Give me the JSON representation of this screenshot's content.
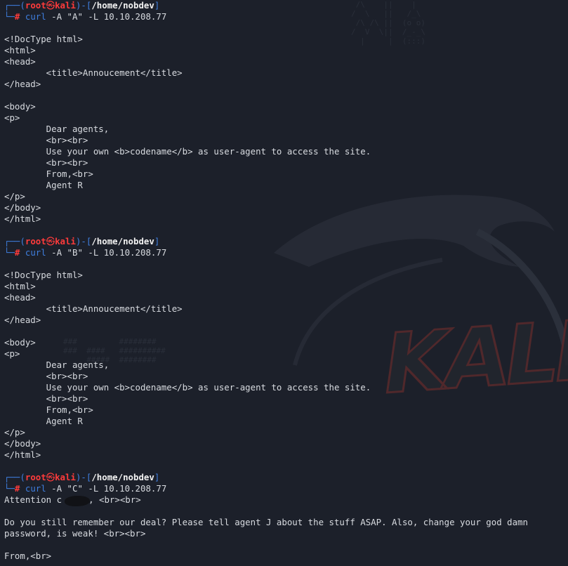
{
  "prompt": {
    "user": "root",
    "skull_glyph": "㉿",
    "host": "kali",
    "path": "/home/nobdev",
    "symbol": "#"
  },
  "sessions": [
    {
      "command": "curl",
      "args": " -A \"A\" -L 10.10.208.77",
      "output": [
        "",
        "<!DocType html>",
        "<html>",
        "<head>",
        "        <title>Annoucement</title>",
        "</head>",
        "",
        "<body>",
        "<p>",
        "        Dear agents,",
        "        <br><br>",
        "        Use your own <b>codename</b> as user-agent to access the site.",
        "        <br><br>",
        "        From,<br>",
        "        Agent R",
        "</p>",
        "</body>",
        "</html>",
        ""
      ]
    },
    {
      "command": "curl",
      "args": " -A \"B\" -L 10.10.208.77",
      "output": [
        "",
        "<!DocType html>",
        "<html>",
        "<head>",
        "        <title>Annoucement</title>",
        "</head>",
        "",
        "<body>",
        "<p>",
        "        Dear agents,",
        "        <br><br>",
        "        Use your own <b>codename</b> as user-agent to access the site.",
        "        <br><br>",
        "        From,<br>",
        "        Agent R",
        "</p>",
        "</body>",
        "</html>",
        ""
      ]
    },
    {
      "command": "curl",
      "args": " -A \"C\" -L 10.10.208.77",
      "attention_prefix": "Attention c",
      "attention_suffix": ", <br><br>",
      "output": [
        "",
        "Do you still remember our deal? Please tell agent J about the stuff ASAP. Also, change your god damn",
        "password, is weak! <br><br>",
        "",
        "From,<br>"
      ]
    }
  ],
  "colors": {
    "background": "#1c202a",
    "text": "#d8dbe0",
    "prompt_box": "#3f7fe0",
    "prompt_user": "#ff3b3b",
    "command": "#3f7fe0"
  }
}
